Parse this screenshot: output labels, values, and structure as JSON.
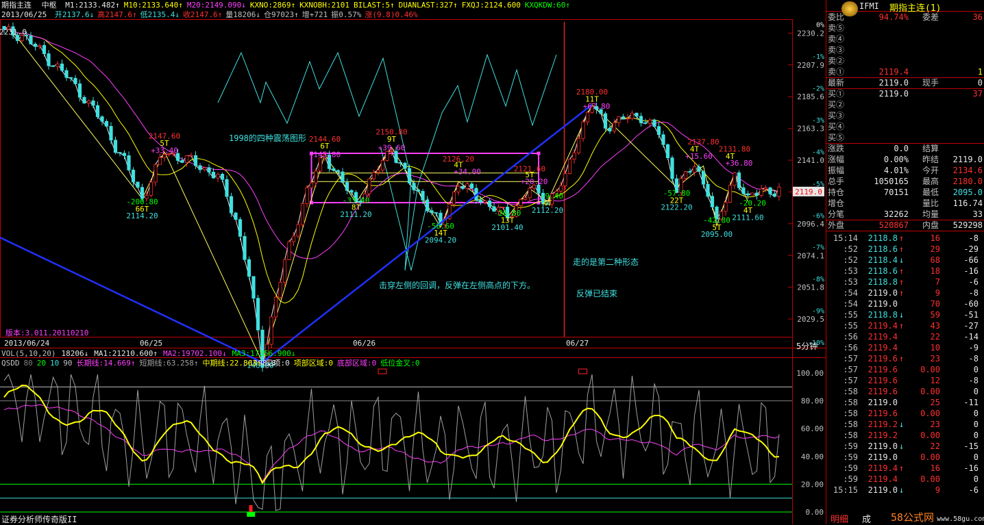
{
  "window": {
    "title": "期指主连",
    "mode": "中枢",
    "date": "2013/06/25",
    "version_note": "版本:3.011.20110210",
    "software": "证券分析师传奇版II",
    "period": "5分钟",
    "symbol": "IFMI",
    "symbol_name": "期指主连(1)",
    "watermark": "58公式网",
    "watermark_url": "www.58gu.com"
  },
  "header_line1": [
    {
      "text": "M1:2133.482",
      "color": "#e8e8e8",
      "arrow": "↑"
    },
    {
      "text": "M10:2133.640",
      "color": "#ffff00",
      "arrow": "↑"
    },
    {
      "text": "M20:2149.090",
      "color": "#ff40ff",
      "arrow": "↓"
    },
    {
      "text": "KXNO:2869",
      "color": "#ffff00",
      "arrow": "↑"
    },
    {
      "text": "KXNOBH:2101",
      "color": "#ffff00",
      "arrow": ""
    },
    {
      "text": "BILAST:5",
      "color": "#ffff00",
      "arrow": "↑"
    },
    {
      "text": "DUANLAST:327",
      "color": "#ffff00",
      "arrow": "↑"
    },
    {
      "text": "FXQJ:2124.600",
      "color": "#ffff00",
      "arrow": ""
    },
    {
      "text": "KXQKDW:60",
      "color": "#00ff00",
      "arrow": "↑"
    }
  ],
  "header_line2": [
    {
      "text": "开2137.6",
      "color": "#40e0e0",
      "arrow": "↓"
    },
    {
      "text": "高2147.6",
      "color": "#ff3030",
      "arrow": "↑"
    },
    {
      "text": "低2135.4",
      "color": "#40e0e0",
      "arrow": "↓"
    },
    {
      "text": "收2147.6",
      "color": "#ff3030",
      "arrow": "↑"
    },
    {
      "text": "量18206",
      "color": "#c0c0c0",
      "arrow": "↓"
    },
    {
      "text": "仓97023",
      "color": "#c0c0c0",
      "arrow": "↑"
    },
    {
      "text": "增+721",
      "color": "#c0c0c0",
      "arrow": ""
    },
    {
      "text": "振0.57%",
      "color": "#c0c0c0",
      "arrow": ""
    },
    {
      "text": "涨(9.8)0.46%",
      "color": "#ff3030",
      "arrow": ""
    }
  ],
  "vol_line": [
    {
      "text": "VOL(5,10,20)",
      "color": "#c0c0c0"
    },
    {
      "text": "18206↓",
      "color": "#e8e8e8"
    },
    {
      "text": "MA1:21210.600↑",
      "color": "#e8e8e8"
    },
    {
      "text": "MA2:19702.100↓",
      "color": "#ff40ff"
    },
    {
      "text": "MA3:17356.900↓",
      "color": "#00ff00"
    }
  ],
  "qsdd_line": [
    {
      "text": "QSDD",
      "color": "#c0c0c0"
    },
    {
      "text": "80",
      "color": "#808080"
    },
    {
      "text": "20",
      "color": "#00ff00"
    },
    {
      "text": "10",
      "color": "#40e0e0"
    },
    {
      "text": "90",
      "color": "#c0c0c0"
    },
    {
      "text": "长期线:14.669↑",
      "color": "#ff40ff"
    },
    {
      "text": "短期线:63.258↑",
      "color": "#a0a0a0"
    },
    {
      "text": "中期线:22.863↑",
      "color": "#ffff00"
    },
    {
      "text": "见项:0",
      "color": "#e8e8e8"
    },
    {
      "text": "项部区域:0",
      "color": "#ffff00"
    },
    {
      "text": "底部区域:0",
      "color": "#ff40ff"
    },
    {
      "text": "低位金叉:0",
      "color": "#00ff00"
    }
  ],
  "chart_data": {
    "type": "candlestick",
    "price_axis": {
      "ylim": [
        2018,
        2240
      ],
      "ticks": [
        2230.2,
        2207.9,
        2185.6,
        2163.3,
        2141.0,
        2118.7,
        2096.4,
        2074.1,
        2051.8,
        2029.5
      ],
      "pct_ticks": [
        "0%",
        "-1%",
        "-2%",
        "-3%",
        "-4%",
        "-5%",
        "-6%",
        "-7%",
        "-8%",
        "-9%",
        "-10%"
      ],
      "current": "2119.0"
    },
    "x_ticks": [
      "2013/06/24",
      "06/25",
      "06/26",
      "06/27"
    ],
    "ma": [
      "M1",
      "M10",
      "M20"
    ],
    "labels": [
      {
        "text": "2231.0",
        "color": "#e8e8e8",
        "price": 2231.0,
        "bar": 2
      },
      {
        "text": "1998.8",
        "color": "#e8e8e8",
        "price": 1998.8,
        "bar": 58
      },
      {
        "text": "2147.60",
        "color": "#ff3030",
        "price": 2158,
        "bar": 36
      },
      {
        "text": "5T",
        "color": "#ffff00",
        "price": 2153,
        "bar": 36
      },
      {
        "text": "+33.40",
        "color": "#ff40ff",
        "price": 2148,
        "bar": 36
      },
      {
        "text": "-200.80",
        "color": "#00ff00",
        "price": 2112,
        "bar": 31
      },
      {
        "text": "66T",
        "color": "#ffff00",
        "price": 2107,
        "bar": 31
      },
      {
        "text": "2114.20",
        "color": "#40e0e0",
        "price": 2102,
        "bar": 31
      },
      {
        "text": "-148.80",
        "color": "#40e0e0",
        "price": 1997,
        "bar": 57
      },
      {
        "text": "2144.60",
        "color": "#ff3030",
        "price": 2156,
        "bar": 72
      },
      {
        "text": "6T",
        "color": "#ffff00",
        "price": 2151,
        "bar": 72
      },
      {
        "text": "+145.80",
        "color": "#ff40ff",
        "price": 2145,
        "bar": 72
      },
      {
        "text": "-33.40",
        "color": "#00ff00",
        "price": 2113,
        "bar": 79
      },
      {
        "text": "8T",
        "color": "#ffff00",
        "price": 2108,
        "bar": 79
      },
      {
        "text": "2111.20",
        "color": "#40e0e0",
        "price": 2103,
        "bar": 79
      },
      {
        "text": "2150.80",
        "color": "#ff3030",
        "price": 2161,
        "bar": 87
      },
      {
        "text": "9T",
        "color": "#ffff00",
        "price": 2156,
        "bar": 87
      },
      {
        "text": "+39.60",
        "color": "#ff40ff",
        "price": 2150,
        "bar": 87
      },
      {
        "text": "2126.20",
        "color": "#ff3030",
        "price": 2142,
        "bar": 102
      },
      {
        "text": "4T",
        "color": "#ffff00",
        "price": 2138,
        "bar": 102
      },
      {
        "text": "+34.00",
        "color": "#ff40ff",
        "price": 2133,
        "bar": 104
      },
      {
        "text": "-56.60",
        "color": "#00ff00",
        "price": 2095,
        "bar": 98
      },
      {
        "text": "14T",
        "color": "#ffff00",
        "price": 2090,
        "bar": 98
      },
      {
        "text": "2094.20",
        "color": "#40e0e0",
        "price": 2085,
        "bar": 98
      },
      {
        "text": "2121.60",
        "color": "#ff3030",
        "price": 2135,
        "bar": 118
      },
      {
        "text": "5T",
        "color": "#ffff00",
        "price": 2131,
        "bar": 118
      },
      {
        "text": "+20.20",
        "color": "#ff40ff",
        "price": 2126,
        "bar": 119
      },
      {
        "text": "-26.80",
        "color": "#00ff00",
        "price": 2104,
        "bar": 113
      },
      {
        "text": "13T",
        "color": "#ffff00",
        "price": 2099,
        "bar": 113
      },
      {
        "text": "2101.40",
        "color": "#40e0e0",
        "price": 2094,
        "bar": 113
      },
      {
        "text": "-9.40",
        "color": "#00ff00",
        "price": 2116,
        "bar": 123
      },
      {
        "text": "4T",
        "color": "#ffff00",
        "price": 2111,
        "bar": 122
      },
      {
        "text": "2112.20",
        "color": "#40e0e0",
        "price": 2106,
        "bar": 122
      },
      {
        "text": "2180.00",
        "color": "#ff3030",
        "price": 2189,
        "bar": 132
      },
      {
        "text": "11T",
        "color": "#ffff00",
        "price": 2184,
        "bar": 132
      },
      {
        "text": "+67.80",
        "color": "#ff40ff",
        "price": 2179,
        "bar": 133
      },
      {
        "text": "2137.80",
        "color": "#ff3030",
        "price": 2154,
        "bar": 157
      },
      {
        "text": "4T",
        "color": "#ffff00",
        "price": 2149,
        "bar": 155
      },
      {
        "text": "+15.60",
        "color": "#ff40ff",
        "price": 2144,
        "bar": 156
      },
      {
        "text": "-57.80",
        "color": "#00ff00",
        "price": 2118,
        "bar": 151
      },
      {
        "text": "22T",
        "color": "#ffff00",
        "price": 2113,
        "bar": 151
      },
      {
        "text": "2122.20",
        "color": "#40e0e0",
        "price": 2108,
        "bar": 151
      },
      {
        "text": "2131.80",
        "color": "#ff3030",
        "price": 2149,
        "bar": 164
      },
      {
        "text": "4T",
        "color": "#ffff00",
        "price": 2144,
        "bar": 163
      },
      {
        "text": "+36.80",
        "color": "#ff40ff",
        "price": 2139,
        "bar": 165
      },
      {
        "text": "-20.20",
        "color": "#00ff00",
        "price": 2111,
        "bar": 168
      },
      {
        "text": "4T",
        "color": "#ffff00",
        "price": 2106,
        "bar": 167
      },
      {
        "text": "2111.60",
        "color": "#40e0e0",
        "price": 2101,
        "bar": 167
      },
      {
        "text": "-42.80",
        "color": "#00ff00",
        "price": 2099,
        "bar": 160
      },
      {
        "text": "5T",
        "color": "#ffff00",
        "price": 2094,
        "bar": 160
      },
      {
        "text": "2095.00",
        "color": "#40e0e0",
        "price": 2089,
        "bar": 160
      }
    ],
    "annotations": [
      {
        "text": "1998的四种震荡图形",
        "color": "#40e0e0"
      },
      {
        "text": "击穿左侧的回调，反弹在左侧高点的下方。",
        "color": "#40e0e0"
      },
      {
        "text": "走的是第二种形态",
        "color": "#40e0e0"
      },
      {
        "text": "反弹已结束",
        "color": "#40e0e0"
      }
    ],
    "qsdd_axis": {
      "ylim": [
        0,
        100
      ],
      "ticks": [
        "100.00",
        "80.00",
        "60.00",
        "40.00",
        "20.00",
        "0.00"
      ]
    }
  },
  "quote": {
    "weibi_label": "委比",
    "weibi": "94.74%",
    "weicha_label": "委差",
    "weicha": "36",
    "sell": [
      {
        "label": "卖⑤",
        "price": "",
        "vol": ""
      },
      {
        "label": "卖④",
        "price": "",
        "vol": ""
      },
      {
        "label": "卖③",
        "price": "",
        "vol": ""
      },
      {
        "label": "卖②",
        "price": "",
        "vol": ""
      },
      {
        "label": "卖①",
        "price": "2119.4",
        "vol": "1"
      }
    ],
    "last_label": "最新",
    "last": "2119.0",
    "cur_hand_label": "现手",
    "cur_hand": "0",
    "buy": [
      {
        "label": "买①",
        "price": "2119.0",
        "vol": "37"
      },
      {
        "label": "买②",
        "price": "",
        "vol": ""
      },
      {
        "label": "买③",
        "price": "",
        "vol": ""
      },
      {
        "label": "买④",
        "price": "",
        "vol": ""
      },
      {
        "label": "买⑤",
        "price": "",
        "vol": ""
      }
    ],
    "stats": [
      {
        "l1": "涨跌",
        "v1": "0.0",
        "c1": "#e8e8e8",
        "l2": "结算",
        "v2": "",
        "c2": "#e8e8e8"
      },
      {
        "l1": "涨幅",
        "v1": "0.00%",
        "c1": "#e8e8e8",
        "l2": "昨结",
        "v2": "2119.0",
        "c2": "#e8e8e8"
      },
      {
        "l1": "振幅",
        "v1": "4.01%",
        "c1": "#e8e8e8",
        "l2": "今开",
        "v2": "2134.6",
        "c2": "#ff3030"
      },
      {
        "l1": "总手",
        "v1": "1050165",
        "c1": "#e8e8e8",
        "l2": "最高",
        "v2": "2180.0",
        "c2": "#ff3030"
      },
      {
        "l1": "持仓",
        "v1": "70151",
        "c1": "#e8e8e8",
        "l2": "最低",
        "v2": "2095.0",
        "c2": "#40e0e0"
      },
      {
        "l1": "增仓",
        "v1": "",
        "c1": "#e8e8e8",
        "l2": "量比",
        "v2": "116.74",
        "c2": "#e8e8e8"
      },
      {
        "l1": "分笔",
        "v1": "32262",
        "c1": "#e8e8e8",
        "l2": "均量",
        "v2": "33",
        "c2": "#e8e8e8"
      }
    ],
    "outer_label": "外盘",
    "outer": "520867",
    "inner_label": "内盘",
    "inner": "529298"
  },
  "ticks": [
    {
      "time": "15:14",
      "price": "2118.8",
      "pc": "#40e0e0",
      "arr": "↑",
      "ac": "#ff3030",
      "vol": "16",
      "chg": "-8",
      "cc": "#e8e8e8"
    },
    {
      "time": ":52",
      "price": "2118.6",
      "pc": "#40e0e0",
      "arr": "↑",
      "ac": "#ff3030",
      "vol": "29",
      "chg": "-29",
      "cc": "#e8e8e8"
    },
    {
      "time": ":52",
      "price": "2118.4",
      "pc": "#40e0e0",
      "arr": "↓",
      "ac": "#40e0e0",
      "vol": "68",
      "chg": "-66",
      "cc": "#e8e8e8"
    },
    {
      "time": ":53",
      "price": "2118.6",
      "pc": "#40e0e0",
      "arr": "↑",
      "ac": "#ff3030",
      "vol": "18",
      "chg": "-16",
      "cc": "#e8e8e8"
    },
    {
      "time": ":53",
      "price": "2118.8",
      "pc": "#40e0e0",
      "arr": "↑",
      "ac": "#ff3030",
      "vol": "7",
      "chg": "-6",
      "cc": "#e8e8e8"
    },
    {
      "time": ":54",
      "price": "2119.0",
      "pc": "#e8e8e8",
      "arr": "↑",
      "ac": "#ff3030",
      "vol": "9",
      "chg": "-8",
      "cc": "#e8e8e8"
    },
    {
      "time": ":54",
      "price": "2119.0",
      "pc": "#e8e8e8",
      "arr": "",
      "ac": "#ff3030",
      "vol": "70",
      "chg": "-60",
      "cc": "#e8e8e8"
    },
    {
      "time": ":55",
      "price": "2118.8",
      "pc": "#40e0e0",
      "arr": "↓",
      "ac": "#40e0e0",
      "vol": "59",
      "chg": "-51",
      "cc": "#e8e8e8"
    },
    {
      "time": ":55",
      "price": "2119.4",
      "pc": "#ff3030",
      "arr": "↑",
      "ac": "#ff3030",
      "vol": "43",
      "chg": "-27",
      "cc": "#e8e8e8"
    },
    {
      "time": ":56",
      "price": "2119.4",
      "pc": "#ff3030",
      "arr": "",
      "ac": "#ff3030",
      "vol": "22",
      "chg": "-14",
      "cc": "#e8e8e8"
    },
    {
      "time": ":56",
      "price": "2119.4",
      "pc": "#ff3030",
      "arr": "",
      "ac": "#ff3030",
      "vol": "10",
      "chg": "-9",
      "cc": "#e8e8e8"
    },
    {
      "time": ":57",
      "price": "2119.6",
      "pc": "#ff3030",
      "arr": "↑",
      "ac": "#ff3030",
      "vol": "23",
      "chg": "-8",
      "cc": "#e8e8e8"
    },
    {
      "time": ":57",
      "price": "2119.6",
      "pc": "#ff3030",
      "arr": "",
      "ac": "#ff3030",
      "vol": "0.00",
      "chg": "0",
      "cc": "#e8e8e8"
    },
    {
      "time": ":57",
      "price": "2119.6",
      "pc": "#ff3030",
      "arr": "",
      "ac": "#ff3030",
      "vol": "12",
      "chg": "-8",
      "cc": "#e8e8e8"
    },
    {
      "time": ":58",
      "price": "2119.6",
      "pc": "#ff3030",
      "arr": "",
      "ac": "#ff3030",
      "vol": "0.00",
      "chg": "0",
      "cc": "#e8e8e8"
    },
    {
      "time": ":58",
      "price": "2119.0",
      "pc": "#e8e8e8",
      "arr": "",
      "ac": "#ff3030",
      "vol": "25",
      "chg": "-11",
      "cc": "#e8e8e8"
    },
    {
      "time": ":58",
      "price": "2119.6",
      "pc": "#ff3030",
      "arr": "",
      "ac": "#ff3030",
      "vol": "0.00",
      "chg": "0",
      "cc": "#e8e8e8"
    },
    {
      "time": ":58",
      "price": "2119.2",
      "pc": "#ff3030",
      "arr": "↓",
      "ac": "#40e0e0",
      "vol": "23",
      "chg": "0",
      "cc": "#e8e8e8"
    },
    {
      "time": ":58",
      "price": "2119.2",
      "pc": "#ff3030",
      "arr": "",
      "ac": "#ff3030",
      "vol": "0.00",
      "chg": "0",
      "cc": "#e8e8e8"
    },
    {
      "time": ":59",
      "price": "2119.0",
      "pc": "#e8e8e8",
      "arr": "↓",
      "ac": "#40e0e0",
      "vol": "22",
      "chg": "-15",
      "cc": "#e8e8e8"
    },
    {
      "time": ":59",
      "price": "2119.0",
      "pc": "#e8e8e8",
      "arr": "",
      "ac": "#ff3030",
      "vol": "0.00",
      "chg": "0",
      "cc": "#e8e8e8"
    },
    {
      "time": ":59",
      "price": "2119.4",
      "pc": "#ff3030",
      "arr": "↑",
      "ac": "#ff3030",
      "vol": "16",
      "chg": "-16",
      "cc": "#e8e8e8"
    },
    {
      "time": ":59",
      "price": "2119.4",
      "pc": "#ff3030",
      "arr": "",
      "ac": "#ff3030",
      "vol": "0.00",
      "chg": "0",
      "cc": "#e8e8e8"
    },
    {
      "time": "15:15",
      "price": "2119.0",
      "pc": "#e8e8e8",
      "arr": "↓",
      "ac": "#40e0e0",
      "vol": "9",
      "chg": "-6",
      "cc": "#e8e8e8"
    }
  ],
  "bottom_tabs": {
    "detail": "明细",
    "trade": "成"
  },
  "colors": {
    "bg": "#000000",
    "frame": "#c00000",
    "up": "#ff3030",
    "down": "#40e0e0",
    "ma10": "#ffff00",
    "ma20": "#ff40ff",
    "trend": "#2030ff"
  }
}
